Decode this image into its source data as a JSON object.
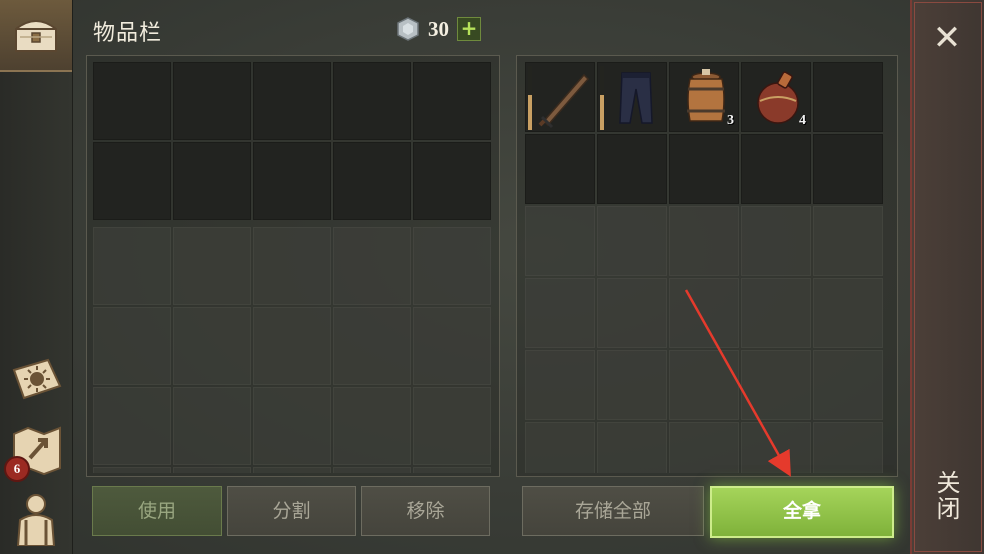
{
  "header": {
    "title": "物品栏",
    "currency_icon": "gem-icon",
    "currency_value": "30",
    "plus_label": "+"
  },
  "sidebar": {
    "items": [
      {
        "icon": "chest-icon"
      },
      {
        "icon": "sun-book-icon"
      },
      {
        "icon": "map-icon",
        "badge": "6"
      },
      {
        "icon": "character-icon"
      }
    ]
  },
  "inventory_buttons": {
    "use": "使用",
    "split": "分割",
    "remove": "移除"
  },
  "storage": {
    "items": [
      {
        "name": "sword-icon",
        "durability": 0.55
      },
      {
        "name": "pants-icon",
        "durability": 0.55
      },
      {
        "name": "barrel-icon",
        "count": "3"
      },
      {
        "name": "flask-icon",
        "count": "4"
      }
    ],
    "store_all": "存储全部",
    "take_all": "全拿"
  },
  "close": {
    "label": "关闭",
    "icon": "close-icon",
    "glyph": "✕"
  },
  "colors": {
    "accent_green": "#8fc446",
    "annotation_arrow": "#e53a2c",
    "durability": "#c9a063"
  }
}
